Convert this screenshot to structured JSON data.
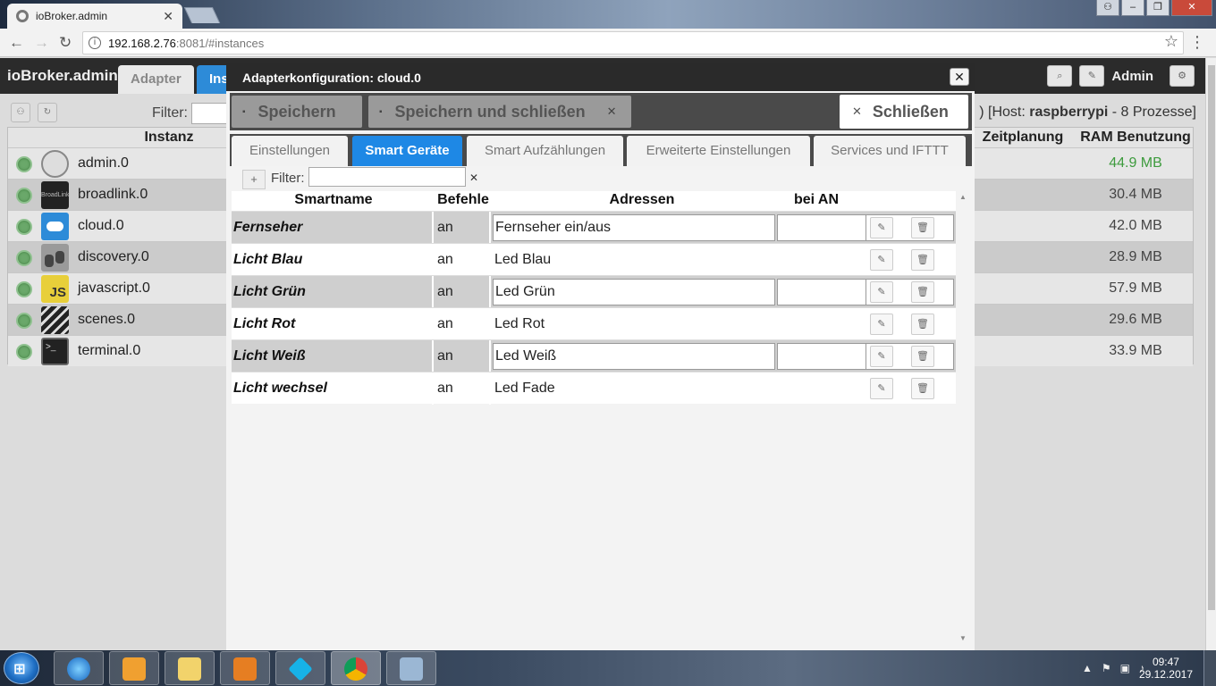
{
  "browser": {
    "tab_title": "ioBroker.admin",
    "tab_close": "✕",
    "url_host": "192.168.2.76",
    "url_rest": ":8081/#instances",
    "win_min": "‒",
    "win_max": "❐",
    "win_close": "✕"
  },
  "app": {
    "brand": "ioBroker.admin",
    "tabs": [
      "Adapter",
      "Ins"
    ],
    "user": "Admin"
  },
  "instances": {
    "filter_label": "Filter:",
    "host_prefix": ") [Host: ",
    "host_name": "raspberrypi",
    "host_suffix": " - 8 Prozesse]",
    "col_instance": "Instanz",
    "col_schedule": "Zeitplanung",
    "col_ram": "RAM Benutzung",
    "rows": [
      {
        "name": "admin.0",
        "ram": "44.9 MB",
        "icon": "gear-icon"
      },
      {
        "name": "broadlink.0",
        "ram": "30.4 MB",
        "icon": "broadlink-icon"
      },
      {
        "name": "cloud.0",
        "ram": "42.0 MB",
        "icon": "cloud-icon"
      },
      {
        "name": "discovery.0",
        "ram": "28.9 MB",
        "icon": "binoculars-icon"
      },
      {
        "name": "javascript.0",
        "ram": "57.9 MB",
        "icon": "js-icon"
      },
      {
        "name": "scenes.0",
        "ram": "29.6 MB",
        "icon": "clapper-icon"
      },
      {
        "name": "terminal.0",
        "ram": "33.9 MB",
        "icon": "terminal-icon"
      }
    ]
  },
  "dialog": {
    "title": "Adapterkonfiguration: cloud.0",
    "close_glyph": "✕",
    "save": "Speichern",
    "save_close": "Speichern und schließen",
    "close": "Schließen",
    "tabs": [
      "Einstellungen",
      "Smart Geräte",
      "Smart Aufzählungen",
      "Erweiterte Einstellungen",
      "Services und IFTTT"
    ],
    "active_tab": "Smart Geräte",
    "filter_label": "Filter:",
    "filter_value": "",
    "columns": {
      "smartname": "Smartname",
      "befehle": "Befehle",
      "adressen": "Adressen",
      "bei_an": "bei AN"
    },
    "rows": [
      {
        "name": "Fernseher",
        "cmd": "an",
        "addr": "Fernseher ein/aus",
        "editing": true
      },
      {
        "name": "Licht Blau",
        "cmd": "an",
        "addr": "Led Blau",
        "editing": false
      },
      {
        "name": "Licht Grün",
        "cmd": "an",
        "addr": "Led Grün",
        "editing": true
      },
      {
        "name": "Licht Rot",
        "cmd": "an",
        "addr": "Led Rot",
        "editing": false
      },
      {
        "name": "Licht Weiß",
        "cmd": "an",
        "addr": "Led Weiß",
        "editing": true
      },
      {
        "name": "Licht wechsel",
        "cmd": "an",
        "addr": "Led Fade",
        "editing": false
      }
    ]
  },
  "taskbar": {
    "time": "09:47",
    "date": "29.12.2017"
  },
  "colors": {
    "accent": "#1e88e5",
    "led_on": "#6aa86a",
    "ram_green": "#3d9b3d"
  }
}
